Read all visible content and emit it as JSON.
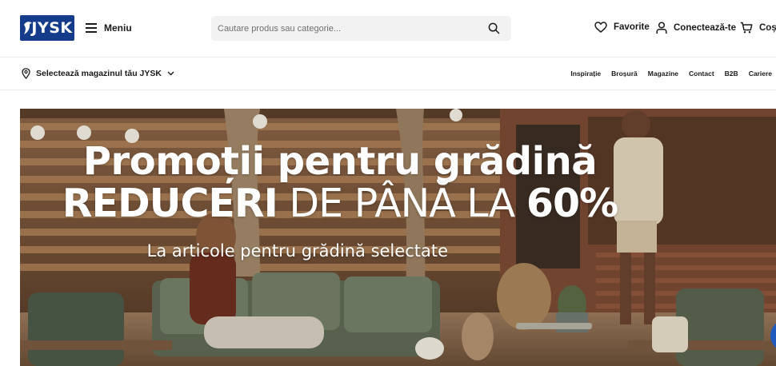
{
  "brand": {
    "logo_text": "JYSK",
    "color": "#143c8a"
  },
  "header": {
    "menu_label": "Meniu",
    "search_placeholder": "Cautare produs sau categorie...",
    "favorites_label": "Favorite",
    "login_label": "Conectează-te",
    "cart_label": "Coș"
  },
  "subbar": {
    "store_label": "Selectează magazinul tău JYSK",
    "links": [
      "Inspirație",
      "Broșură",
      "Magazine",
      "Contact",
      "B2B",
      "Cariere"
    ]
  },
  "hero": {
    "title": "Promoții pentru grădină",
    "sub_bold": "REDUCERI",
    "sub_light": " DE PÂNĂ LA ",
    "sub_percent": "60%",
    "note": "La articole pentru grădină selectate"
  },
  "icons": {
    "menu": "hamburger-icon",
    "search": "search-icon",
    "favorites": "heart-icon",
    "login": "user-icon",
    "cart": "cart-icon",
    "store": "location-pin-icon",
    "chevron": "chevron-down-icon"
  }
}
